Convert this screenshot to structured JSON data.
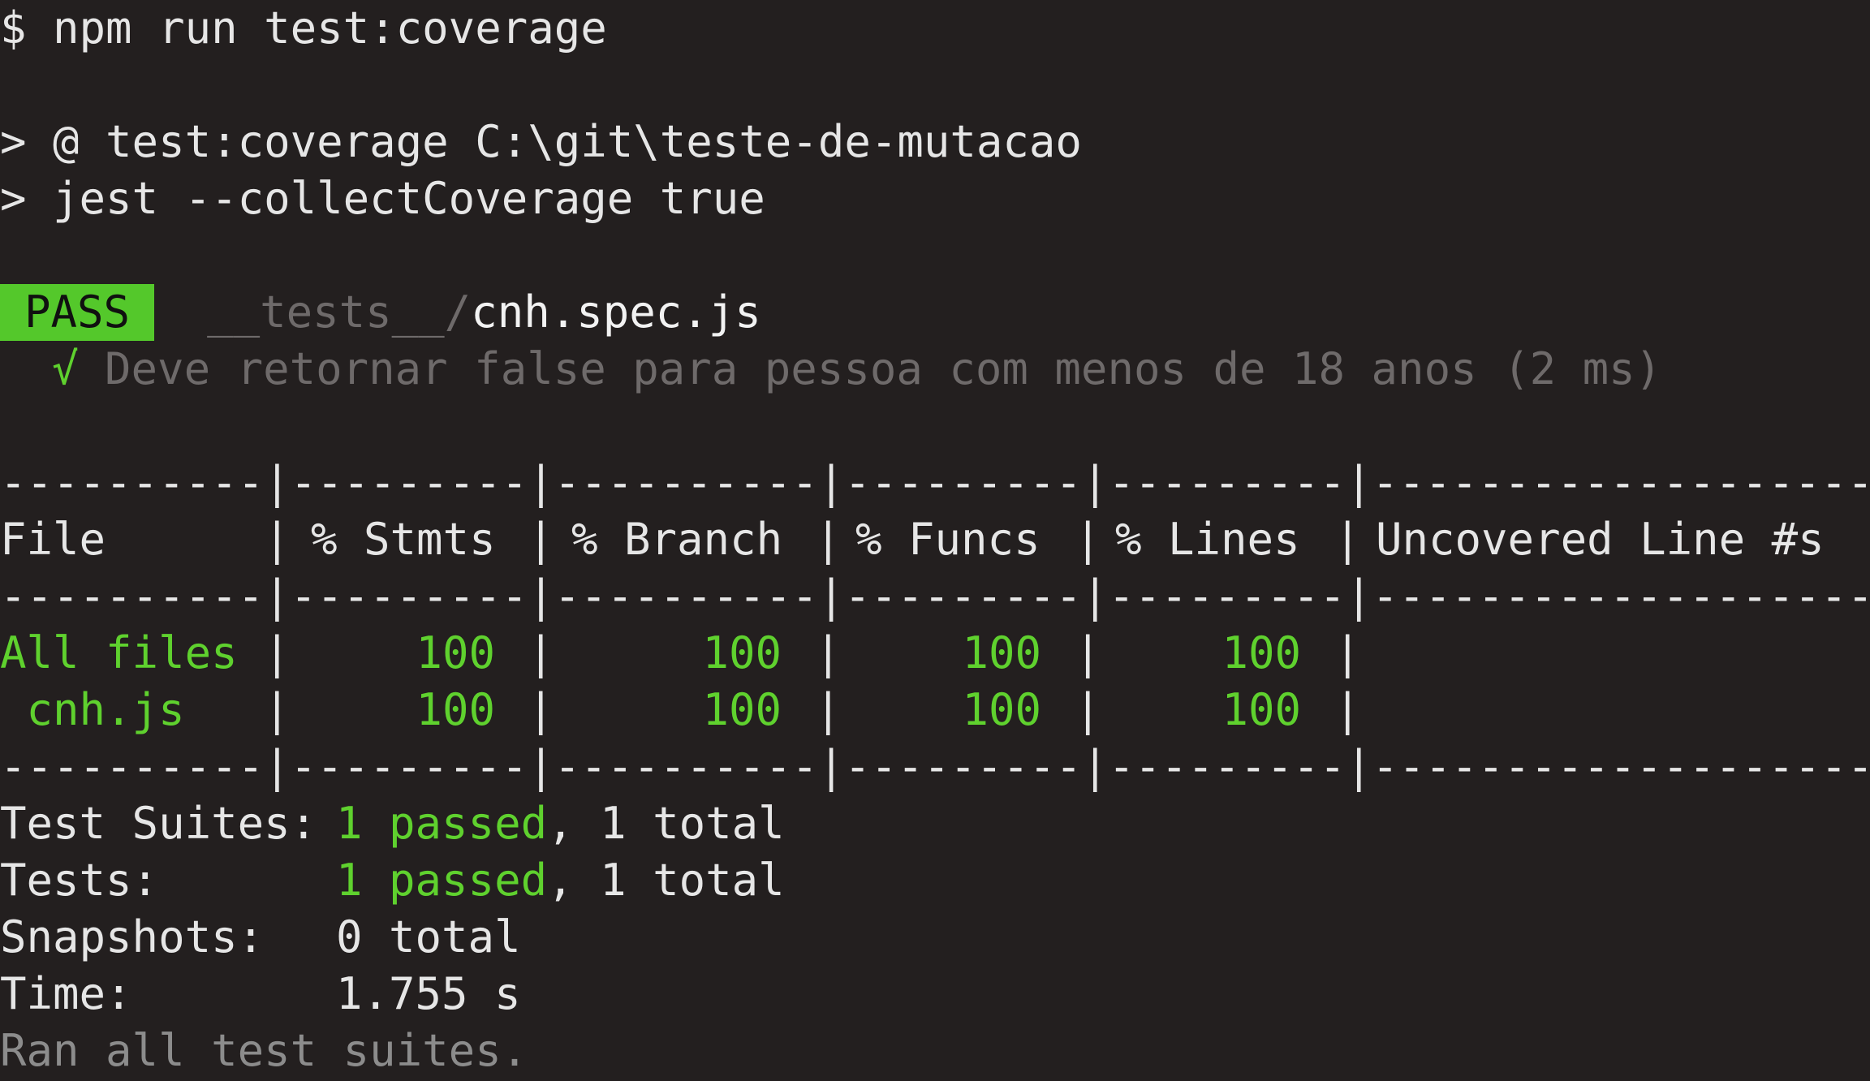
{
  "terminal": {
    "command_prompt": "$ npm run test:coverage",
    "script_lines": [
      "> @ test:coverage C:\\git\\teste-de-mutacao",
      "> jest --collectCoverage true"
    ],
    "pass_badge": "PASS",
    "test_file_dir": "__tests__/",
    "test_file_name": "cnh.spec.js",
    "test_check": "√",
    "test_case": "Deve retornar false para pessoa com menos de 18 anos (2 ms)",
    "table": {
      "divider": "----------|---------|----------|---------|---------|-------------------",
      "headers": [
        "File",
        "% Stmts",
        "% Branch",
        "% Funcs",
        "% Lines",
        "Uncovered Line #s"
      ],
      "rows": [
        {
          "file": "All files",
          "stmts": "100",
          "branch": "100",
          "funcs": "100",
          "lines": "100",
          "uncovered": ""
        },
        {
          "file": " cnh.js",
          "stmts": "100",
          "branch": "100",
          "funcs": "100",
          "lines": "100",
          "uncovered": ""
        }
      ]
    },
    "summary": {
      "suites_label": "Test Suites:",
      "suites_passed": "1 passed",
      "suites_total": ", 1 total",
      "tests_label": "Tests:",
      "tests_passed": "1 passed",
      "tests_total": ", 1 total",
      "snapshots_label": "Snapshots:",
      "snapshots_value": "0 total",
      "time_label": "Time:",
      "time_value": "1.755 s",
      "ran_all": "Ran all test suites."
    }
  },
  "colors": {
    "background": "#231f1f",
    "pass_green": "#5fd12e",
    "badge_green": "#54c82b",
    "text": "#e6e6e6",
    "muted": "#8c8c8c"
  }
}
